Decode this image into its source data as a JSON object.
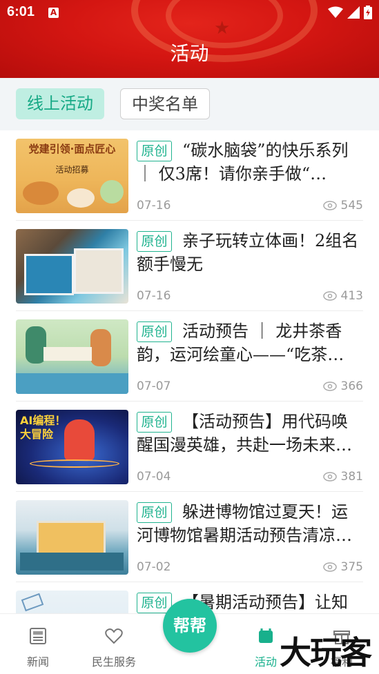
{
  "status": {
    "time": "6:01",
    "notif": "A"
  },
  "header": {
    "title": "活动"
  },
  "tabs": [
    {
      "label": "线上活动",
      "active": true
    },
    {
      "label": "中奖名单",
      "active": false
    }
  ],
  "items": [
    {
      "badge": "原创",
      "title": "“碳水脑袋”的快乐系列 ｜ 仅3席！请你亲手做“…",
      "date": "07-16",
      "views": "545",
      "thumb_text": "党建引领·面点匠心",
      "thumb_sub": "活动招募"
    },
    {
      "badge": "原创",
      "title": "亲子玩转立体画！2组名额手慢无",
      "date": "07-16",
      "views": "413"
    },
    {
      "badge": "原创",
      "title": "活动预告 ｜ 龙井茶香韵，运河绘童心——“吃茶…",
      "date": "07-07",
      "views": "366"
    },
    {
      "badge": "原创",
      "title": "【活动预告】用代码唤醒国漫英雄，共赴一场未来…",
      "date": "07-04",
      "views": "381",
      "thumb_text": "AI编程！大冒险"
    },
    {
      "badge": "原创",
      "title": "躲进博物馆过夏天！运河博物馆暑期活动预告清凉…",
      "date": "07-02",
      "views": "375"
    },
    {
      "badge": "原创",
      "title": "【暑期活动预告】让知",
      "date": "",
      "views": ""
    }
  ],
  "nav": {
    "news": "新闻",
    "service": "民生服务",
    "center": "帮帮",
    "activity": "活动",
    "mine": "福利"
  },
  "watermark": "大玩客",
  "colors": {
    "header_red": "#d41612",
    "accent_green": "#20b38f"
  }
}
